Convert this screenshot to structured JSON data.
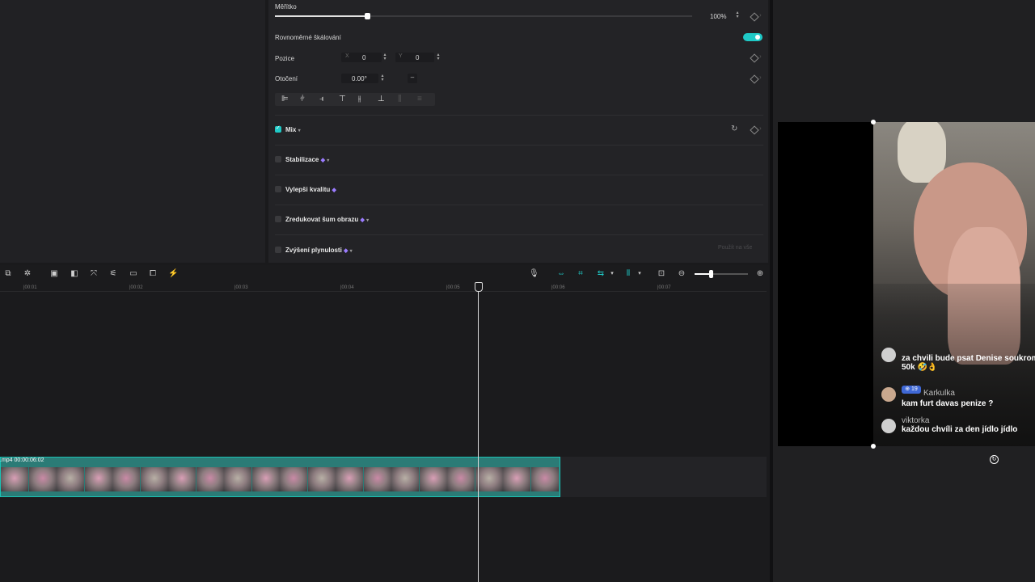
{
  "properties": {
    "scale_label": "Měřítko",
    "scale_value": "100%",
    "scale_fraction": 0.22,
    "uniform_label": "Rovnoměrné škálování",
    "uniform_on": true,
    "position_label": "Pozice",
    "x_label": "X",
    "x_value": "0",
    "y_label": "Y",
    "y_value": "0",
    "rotation_label": "Otočení",
    "rotation_value": "0.00°",
    "rotation_extra": "–",
    "mix_label": "Mix",
    "stabilize_label": "Stabilizace",
    "enhance_label": "Vylepši kvalitu",
    "denoise_label": "Zredukovat šum obrazu",
    "smooth_label": "Zvýšení plynulosti",
    "apply_all_label": "Použít na vše"
  },
  "timeline": {
    "ticks": [
      "|00:01",
      "|00:02",
      "|00:03",
      "|00:04",
      "|00:05",
      "|00:06",
      "|00:07"
    ],
    "clip_label": ".mp4  00:00:06:02",
    "zoom_fraction": 0.3
  },
  "player": {
    "comments": [
      {
        "name": "",
        "text": "za chvili bude psat Denise soukrom",
        "text2": "50k 🤣👌"
      },
      {
        "name": "Karkulka",
        "badge": "19",
        "text": "kam furt davas penize ?"
      },
      {
        "name": "viktorka",
        "text": "každou chvíli za den jídlo jídlo"
      }
    ]
  },
  "colors": {
    "accent": "#1fc9c6",
    "clip_border": "#19c2b4",
    "gem": "#9b7cff"
  }
}
